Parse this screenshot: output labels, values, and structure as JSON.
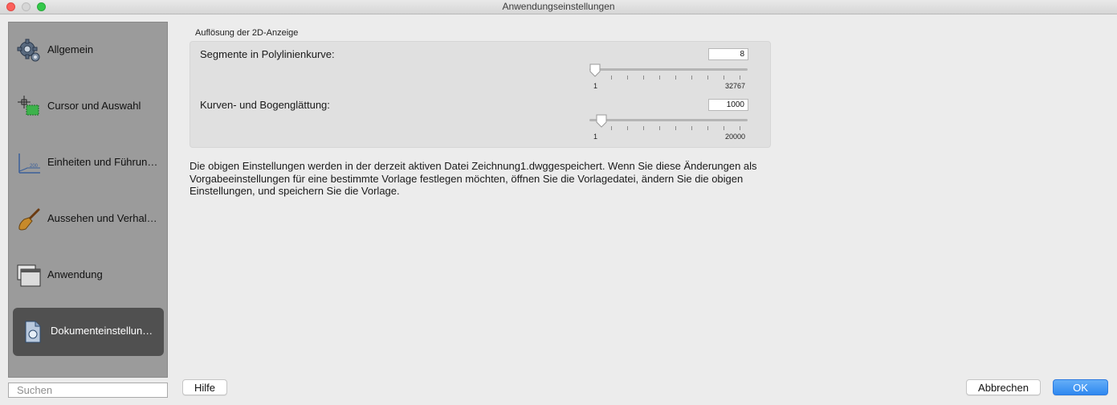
{
  "window": {
    "title": "Anwendungseinstellungen"
  },
  "sidebar": {
    "items": [
      {
        "label": "Allgemein",
        "icon": "gear-icon"
      },
      {
        "label": "Cursor und Auswahl",
        "icon": "crosshair-selection-icon"
      },
      {
        "label": "Einheiten und Führun…",
        "icon": "units-guides-icon"
      },
      {
        "label": "Aussehen und Verhal…",
        "icon": "paintbrush-icon"
      },
      {
        "label": "Anwendung",
        "icon": "application-windows-icon"
      },
      {
        "label": "Dokumenteinstellun…",
        "icon": "document-settings-icon",
        "selected": true
      }
    ]
  },
  "search": {
    "placeholder": "Suchen"
  },
  "section": {
    "title": "Auflösung der 2D-Anzeige",
    "settings": [
      {
        "label": "Segmente in Polylinienkurve:",
        "value": "8",
        "min": "1",
        "max": "32767",
        "level": 0.0
      },
      {
        "label": "Kurven- und Bogenglättung:",
        "value": "1000",
        "min": "1",
        "max": "20000",
        "level": 0.05
      }
    ]
  },
  "description": "Die obigen Einstellungen werden in der derzeit aktiven Datei Zeichnung1.dwggespeichert. Wenn Sie diese Änderungen als Vorgabeeinstellungen für eine bestimmte Vorlage festlegen möchten, öffnen Sie die Vorlagedatei, ändern Sie die obigen Einstellungen, und speichern Sie die Vorlage.",
  "buttons": {
    "help": "Hilfe",
    "cancel": "Abbrechen",
    "ok": "OK"
  },
  "colors": {
    "accent": "#2f88f0",
    "sidebar_bg": "#9b9b9b",
    "selected_bg": "#505050"
  }
}
